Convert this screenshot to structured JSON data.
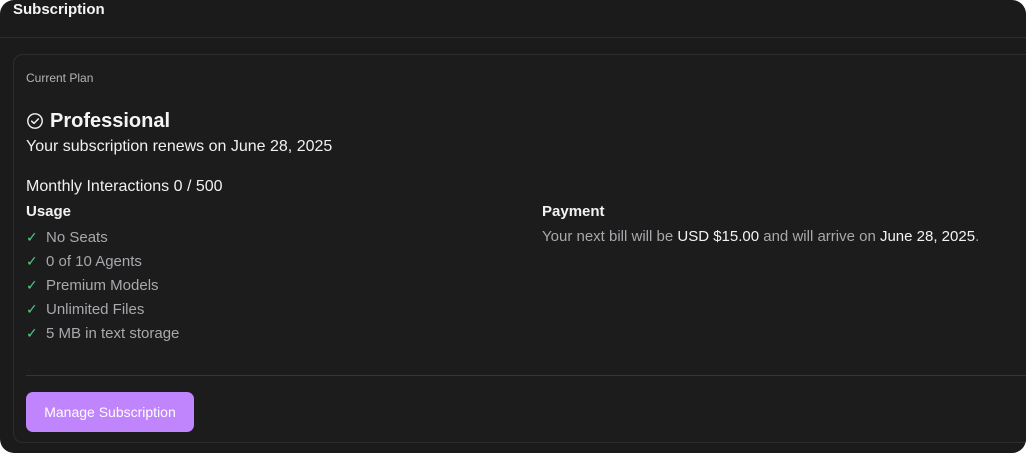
{
  "header": {
    "title": "Subscription"
  },
  "plan": {
    "label": "Current Plan",
    "name": "Professional",
    "renewal_text": "Your subscription renews on June 28, 2025",
    "interactions_text": "Monthly Interactions 0 / 500"
  },
  "usage": {
    "title": "Usage",
    "items": [
      "No Seats",
      "0 of 10 Agents",
      "Premium Models",
      "Unlimited Files",
      "5 MB in text storage"
    ]
  },
  "payment": {
    "title": "Payment",
    "prefix": "Your next bill will be ",
    "amount": "USD $15.00",
    "middle": " and will arrive on ",
    "date": "June 28, 2025",
    "suffix": "."
  },
  "actions": {
    "manage_label": "Manage Subscription"
  },
  "colors": {
    "accent": "#c084fc",
    "check": "#48d182",
    "background": "#1b1b1c"
  }
}
